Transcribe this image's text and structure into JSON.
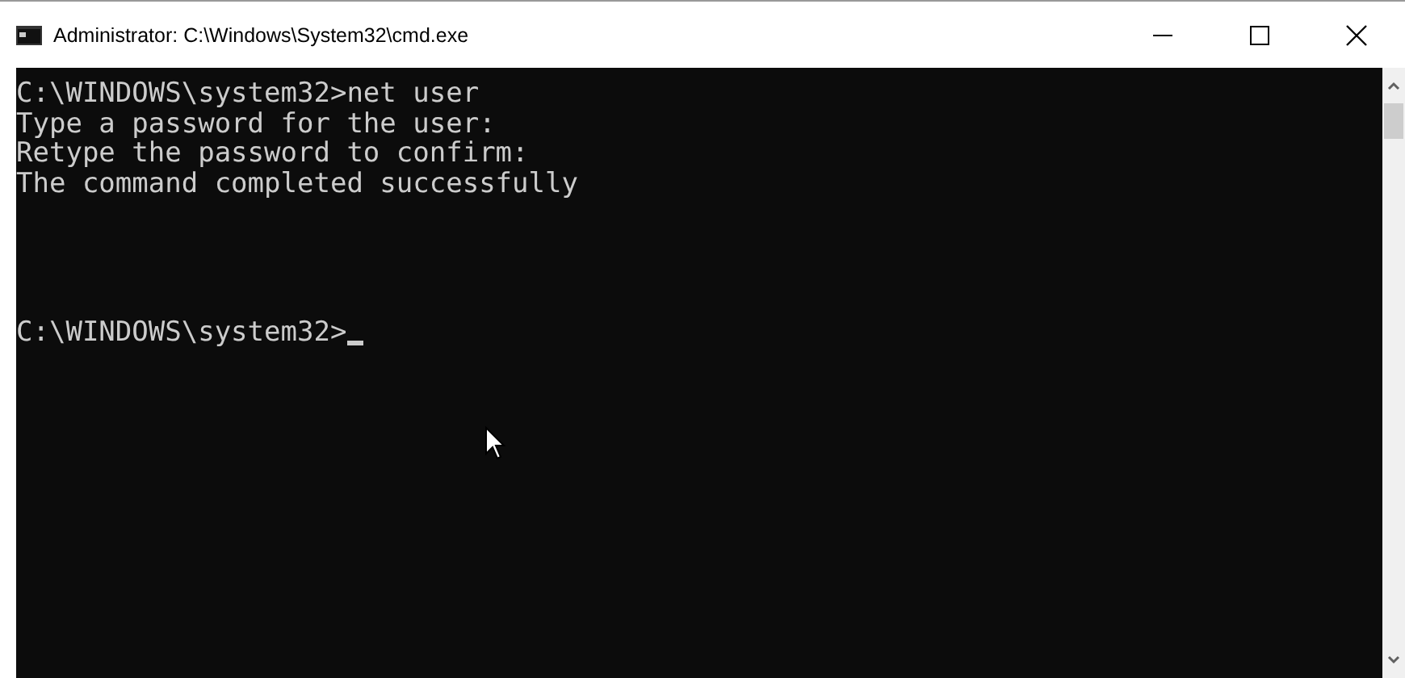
{
  "window": {
    "title": "Administrator: C:\\Windows\\System32\\cmd.exe"
  },
  "console": {
    "lines": [
      "C:\\WINDOWS\\system32>net user",
      "Type a password for the user:",
      "Retype the password to confirm:",
      "The command completed successfully"
    ],
    "prompt": "C:\\WINDOWS\\system32>",
    "cursor": true
  }
}
